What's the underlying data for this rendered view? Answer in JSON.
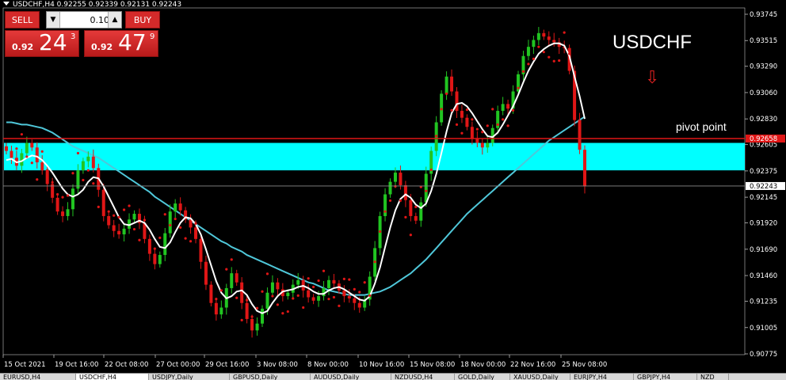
{
  "window": {
    "title": "USDCHF,H4  0.92255 0.92339 0.92131 0.92243",
    "symbol_label": "USDCHF",
    "pivot_label": "pivot point",
    "arrow_icon": "down-arrow-icon"
  },
  "trade_panel": {
    "sell_label": "SELL",
    "buy_label": "BUY",
    "lot_value": "0.10",
    "sell_price": {
      "prefix": "0.92",
      "big": "24",
      "sup": "3"
    },
    "buy_price": {
      "prefix": "0.92",
      "big": "47",
      "sup": "9"
    }
  },
  "tabs": [
    {
      "label": "EURUSD,H4",
      "active": false
    },
    {
      "label": "USDCHF,H4",
      "active": true
    },
    {
      "label": "USDJPY,Daily",
      "active": false
    },
    {
      "label": "GBPUSD,Daily",
      "active": false
    },
    {
      "label": "AUDUSD,Daily",
      "active": false
    },
    {
      "label": "NZDUSD,H4",
      "active": false
    },
    {
      "label": "GOLD,Daily",
      "active": false
    },
    {
      "label": "XAUUSD,Daily",
      "active": false
    },
    {
      "label": "EURJPY,H4",
      "active": false
    },
    {
      "label": "GBPJPY,H4",
      "active": false
    },
    {
      "label": "NZD",
      "active": false
    }
  ],
  "colors": {
    "background": "#000000",
    "bull": "#21c521",
    "bear": "#e01616",
    "sar": "#e01616",
    "ma_fast": "#ffffff",
    "ma_slow": "#4fc7d9",
    "zone": "#00ffff",
    "pivot_line": "#e01616",
    "axis": "#c0c0c0"
  },
  "chart_data": {
    "type": "line",
    "title": "USDCHF",
    "xlabel": "",
    "ylabel": "",
    "ylim": [
      0.90775,
      0.93745
    ],
    "y_ticks": [
      "0.93745",
      "0.93515",
      "0.93290",
      "0.93060",
      "0.92830",
      "0.92605",
      "0.92375",
      "0.92145",
      "0.91920",
      "0.91690",
      "0.91460",
      "0.91235",
      "0.91005",
      "0.90775"
    ],
    "x_ticks": [
      "15 Oct 2021",
      "19 Oct 16:00",
      "22 Oct 08:00",
      "27 Oct 00:00",
      "29 Oct 16:00",
      "3 Nov 08:00",
      "8 Nov 00:00",
      "10 Nov 16:00",
      "15 Nov 08:00",
      "18 Nov 00:00",
      "22 Nov 16:00",
      "25 Nov 08:00"
    ],
    "current_price": "0.92243",
    "pivot_price": "0.92658",
    "support_zone": [
      0.9238,
      0.9262
    ],
    "close_series": [
      0.9255,
      0.9249,
      0.9242,
      0.9253,
      0.9262,
      0.9258,
      0.9245,
      0.9238,
      0.9226,
      0.9214,
      0.9202,
      0.9198,
      0.9204,
      0.9222,
      0.9238,
      0.9246,
      0.925,
      0.924,
      0.9221,
      0.9198,
      0.919,
      0.9185,
      0.9182,
      0.9187,
      0.9195,
      0.92,
      0.9192,
      0.9178,
      0.9165,
      0.9156,
      0.9164,
      0.9183,
      0.9202,
      0.9209,
      0.9203,
      0.9195,
      0.9188,
      0.9178,
      0.9158,
      0.9138,
      0.9122,
      0.9112,
      0.9118,
      0.9135,
      0.9148,
      0.914,
      0.9122,
      0.9108,
      0.9098,
      0.9104,
      0.9117,
      0.9131,
      0.914,
      0.9134,
      0.9128,
      0.9131,
      0.9138,
      0.9142,
      0.9133,
      0.9127,
      0.9124,
      0.9128,
      0.9135,
      0.9142,
      0.9139,
      0.9133,
      0.9128,
      0.9126,
      0.9122,
      0.9118,
      0.9125,
      0.9145,
      0.917,
      0.9198,
      0.9217,
      0.9228,
      0.9236,
      0.9225,
      0.9212,
      0.9198,
      0.9194,
      0.921,
      0.9235,
      0.9255,
      0.928,
      0.9305,
      0.932,
      0.9307,
      0.929,
      0.9284,
      0.9276,
      0.9266,
      0.9262,
      0.9258,
      0.9262,
      0.9275,
      0.929,
      0.9296,
      0.9292,
      0.9307,
      0.9322,
      0.9338,
      0.9346,
      0.9352,
      0.9358,
      0.9355,
      0.9352,
      0.935,
      0.9346,
      0.9345,
      0.9325,
      0.9282,
      0.9256,
      0.9224
    ],
    "series": [
      {
        "name": "",
        "role": "ma_fast",
        "values": [
          0.9247,
          0.9248,
          0.9245,
          0.9246,
          0.9249,
          0.9251,
          0.925,
          0.9247,
          0.9242,
          0.9236,
          0.9229,
          0.9222,
          0.9217,
          0.9215,
          0.9217,
          0.9221,
          0.9228,
          0.9232,
          0.9231,
          0.9224,
          0.9215,
          0.9206,
          0.9197,
          0.9191,
          0.919,
          0.9192,
          0.9194,
          0.9192,
          0.9186,
          0.9178,
          0.9171,
          0.917,
          0.9175,
          0.9184,
          0.9192,
          0.9197,
          0.9196,
          0.9191,
          0.9182,
          0.9169,
          0.9155,
          0.9141,
          0.9131,
          0.9126,
          0.9128,
          0.9132,
          0.9133,
          0.9129,
          0.9121,
          0.9115,
          0.9113,
          0.9115,
          0.9122,
          0.9128,
          0.9132,
          0.9133,
          0.9134,
          0.9136,
          0.9137,
          0.9135,
          0.9132,
          0.913,
          0.913,
          0.9133,
          0.9135,
          0.9136,
          0.9134,
          0.9131,
          0.9128,
          0.9125,
          0.9124,
          0.9128,
          0.9139,
          0.9153,
          0.9171,
          0.9188,
          0.9203,
          0.9213,
          0.9217,
          0.9214,
          0.9208,
          0.9205,
          0.9209,
          0.922,
          0.9235,
          0.9253,
          0.9272,
          0.9288,
          0.9296,
          0.9297,
          0.9294,
          0.9288,
          0.9281,
          0.9274,
          0.9268,
          0.9267,
          0.9271,
          0.9278,
          0.9286,
          0.9294,
          0.9304,
          0.9315,
          0.9325,
          0.9333,
          0.934,
          0.9344,
          0.9347,
          0.9349,
          0.9349,
          0.9347,
          0.9338,
          0.932,
          0.9303,
          0.9283
        ]
      },
      {
        "name": "",
        "role": "ma_slow",
        "values": [
          0.928,
          0.928,
          0.9279,
          0.9278,
          0.9278,
          0.9277,
          0.9276,
          0.9275,
          0.9273,
          0.9271,
          0.9268,
          0.9265,
          0.9262,
          0.9259,
          0.9257,
          0.9255,
          0.9253,
          0.9251,
          0.9249,
          0.9246,
          0.9243,
          0.924,
          0.9237,
          0.9234,
          0.9231,
          0.9228,
          0.9225,
          0.9222,
          0.9219,
          0.9215,
          0.9212,
          0.9209,
          0.9206,
          0.9203,
          0.92,
          0.9197,
          0.9194,
          0.9191,
          0.9188,
          0.9185,
          0.9182,
          0.9179,
          0.9176,
          0.9174,
          0.9171,
          0.9169,
          0.9167,
          0.9164,
          0.9162,
          0.916,
          0.9158,
          0.9156,
          0.9154,
          0.9152,
          0.915,
          0.9148,
          0.9146,
          0.9144,
          0.9142,
          0.914,
          0.9139,
          0.9137,
          0.9135,
          0.9133,
          0.9132,
          0.9131,
          0.913,
          0.9129,
          0.9129,
          0.9129,
          0.9129,
          0.913,
          0.9131,
          0.9132,
          0.9134,
          0.9136,
          0.9139,
          0.9142,
          0.9145,
          0.9148,
          0.9152,
          0.9156,
          0.916,
          0.9165,
          0.917,
          0.9175,
          0.918,
          0.9185,
          0.919,
          0.9195,
          0.92,
          0.9204,
          0.9208,
          0.9212,
          0.9216,
          0.922,
          0.9224,
          0.9228,
          0.9232,
          0.9236,
          0.924,
          0.9244,
          0.9248,
          0.9252,
          0.9256,
          0.926,
          0.9264,
          0.9267,
          0.927,
          0.9273,
          0.9276,
          0.9279,
          0.9282,
          0.9285
        ]
      }
    ],
    "grid": false
  }
}
